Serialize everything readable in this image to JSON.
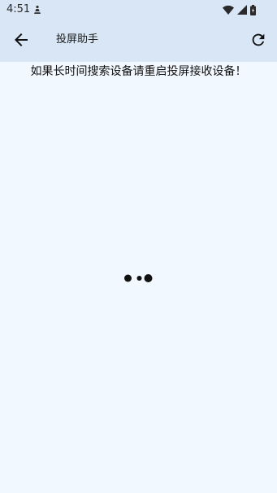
{
  "status_bar": {
    "time": "4:51",
    "icons": [
      "notification-icon",
      "wifi-icon",
      "signal-icon",
      "battery-icon"
    ]
  },
  "app_bar": {
    "title": "投屏助手",
    "back_icon": "arrow-back-icon",
    "refresh_icon": "refresh-icon"
  },
  "content": {
    "hint": "如果长时间搜索设备请重启投屏接收设备！",
    "loading_indicator": "loading-dots"
  },
  "colors": {
    "header_bg": "#d8e6f5",
    "page_bg": "#f2f8ff",
    "icon": "#111111"
  }
}
